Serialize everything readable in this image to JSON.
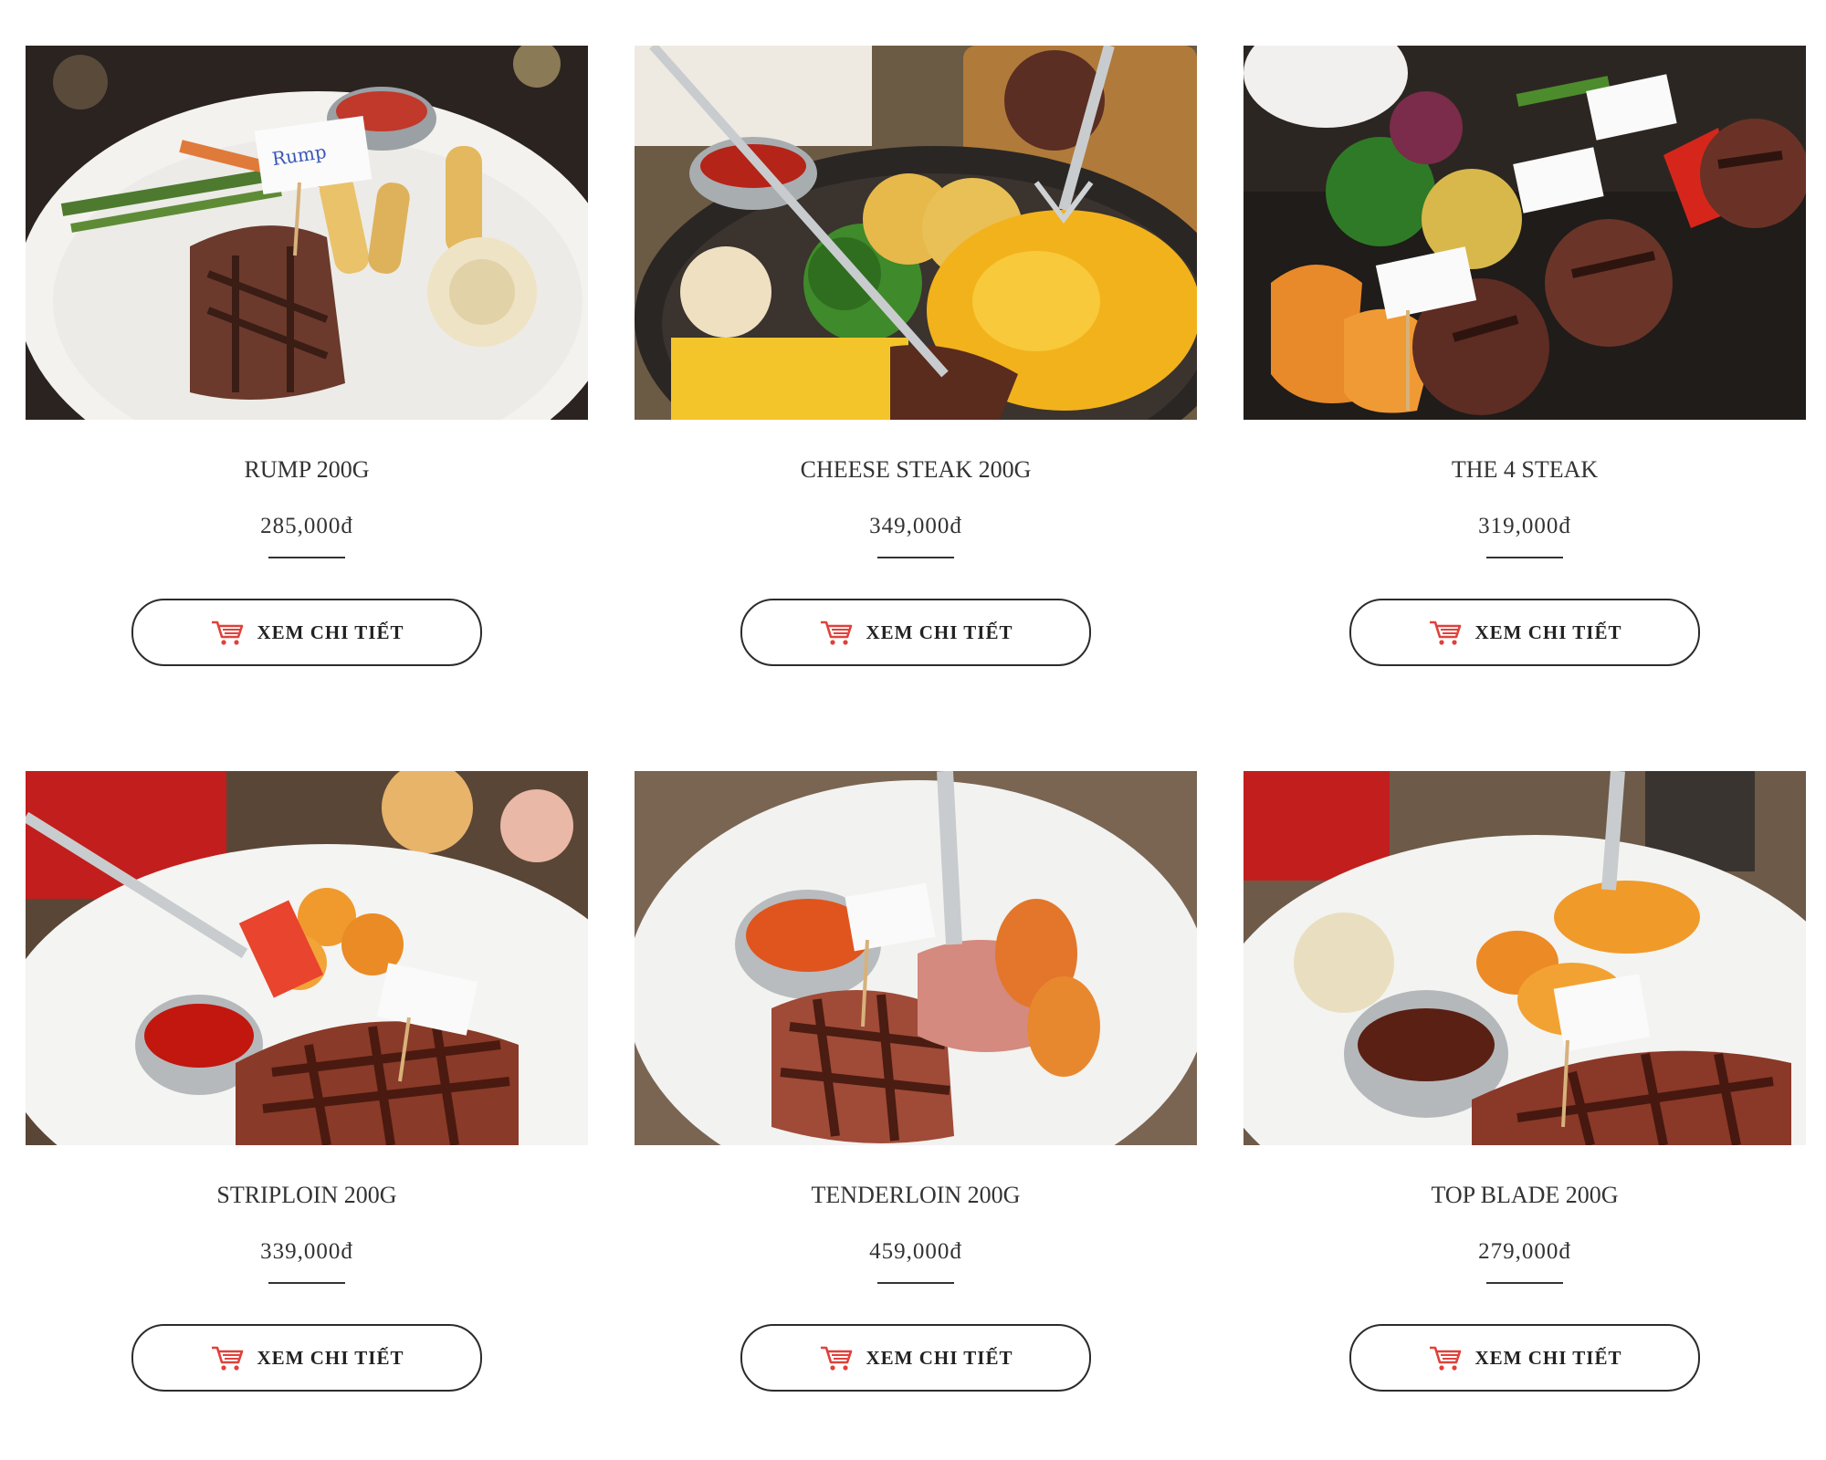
{
  "theme": {
    "accent": "#e0413a",
    "text": "#333333",
    "border": "#2b2b2b"
  },
  "products": [
    {
      "name": "RUMP 200G",
      "price": "285,000đ",
      "button_label": "XEM CHI TIẾT",
      "button_icon": "cart-icon",
      "image": "rump-steak-plate"
    },
    {
      "name": "CHEESE STEAK 200G",
      "price": "349,000đ",
      "button_label": "XEM CHI TIẾT",
      "button_icon": "cart-icon",
      "image": "cheese-steak-skillet"
    },
    {
      "name": "THE 4 STEAK",
      "price": "319,000đ",
      "button_label": "XEM CHI TIẾT",
      "button_icon": "cart-icon",
      "image": "four-steak-platter"
    },
    {
      "name": "STRIPLOIN 200G",
      "price": "339,000đ",
      "button_label": "XEM CHI TIẾT",
      "button_icon": "cart-icon",
      "image": "striploin-plate"
    },
    {
      "name": "TENDERLOIN 200G",
      "price": "459,000đ",
      "button_label": "XEM CHI TIẾT",
      "button_icon": "cart-icon",
      "image": "tenderloin-plate"
    },
    {
      "name": "TOP BLADE 200G",
      "price": "279,000đ",
      "button_label": "XEM CHI TIẾT",
      "button_icon": "cart-icon",
      "image": "top-blade-plate"
    }
  ]
}
